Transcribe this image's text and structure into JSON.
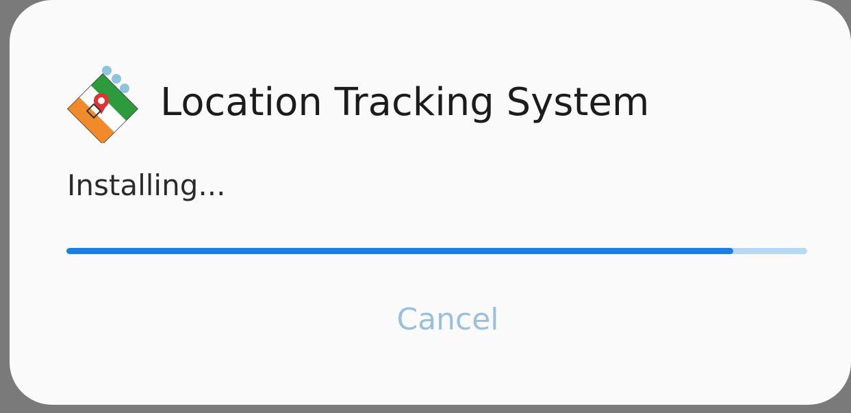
{
  "dialog": {
    "app_name": "Location Tracking System",
    "status": "Installing...",
    "progress_fraction": 0.9,
    "cancel_label": "Cancel"
  },
  "icons": {
    "app": "app-logo-icon"
  },
  "colors": {
    "progress_fill": "#1a7fe0",
    "progress_track": "#b8d7f3",
    "cancel_text": "#9ac0e0",
    "dialog_background": "#fafafa"
  }
}
